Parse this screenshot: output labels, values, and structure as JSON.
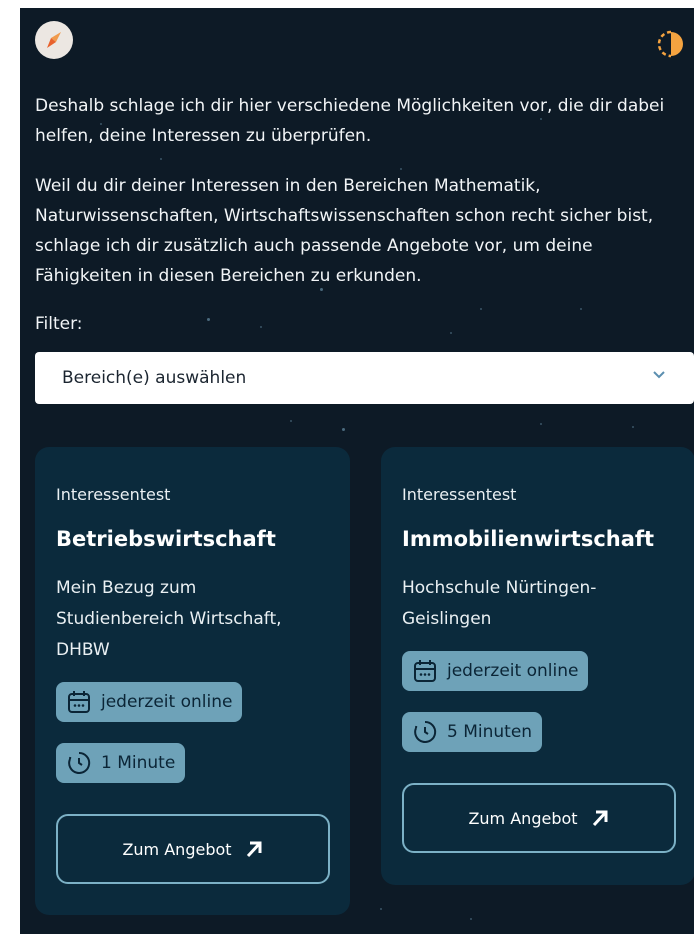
{
  "intro_text": "Deshalb schlage ich dir hier verschiedene Möglichkeiten vor, die dir dabei helfen, deine Interessen zu überprüfen.",
  "interests_text": "Weil du dir deiner Interessen in den Bereichen Mathematik, Naturwissenschaften, Wirtschaftswissenschaften schon recht sicher bist, schlage ich dir zusätzlich auch passende Angebote vor, um deine Fähigkeiten in diesen Bereichen zu erkunden.",
  "filter": {
    "label": "Filter:",
    "placeholder": "Bereich(e) auswählen"
  },
  "cards": [
    {
      "type": "Interessentest",
      "title": "Betriebswirtschaft",
      "description": "Mein Bezug zum Studienbereich Wirtschaft, DHBW",
      "availability": "jederzeit online",
      "duration": "1 Minute",
      "button": "Zum Angebot"
    },
    {
      "type": "Interessentest",
      "title": "Immobilienwirtschaft",
      "description": "Hochschule Nürtingen-Geislingen",
      "availability": "jederzeit online",
      "duration": "5 Minuten",
      "button": "Zum Angebot"
    }
  ],
  "colors": {
    "background": "#0d1a26",
    "card": "#0b2a3c",
    "chip": "#6ea2b8",
    "button_border": "#7cb1c6",
    "accent": "#f4a340"
  },
  "icons": {
    "logo": "compass-icon",
    "theme": "theme-toggle-icon",
    "calendar": "calendar-icon",
    "timer": "timer-icon",
    "external": "arrow-up-right-icon",
    "dropdown": "chevron-down-icon"
  }
}
